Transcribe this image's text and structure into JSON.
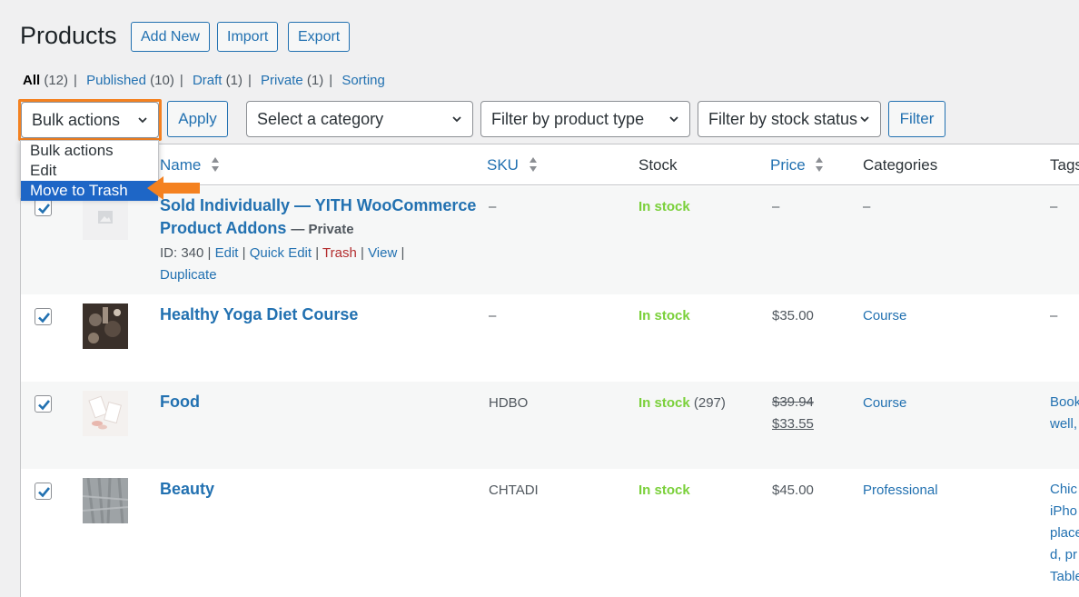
{
  "header": {
    "title": "Products",
    "buttons": [
      "Add New",
      "Import",
      "Export"
    ]
  },
  "views": [
    {
      "label": "All",
      "count": "(12)",
      "current": true
    },
    {
      "label": "Published",
      "count": "(10)"
    },
    {
      "label": "Draft",
      "count": "(1)"
    },
    {
      "label": "Private",
      "count": "(1)"
    },
    {
      "label": "Sorting",
      "count": ""
    }
  ],
  "toolbar": {
    "bulk_actions": "Bulk actions",
    "apply": "Apply",
    "category": "Select a category",
    "product_type": "Filter by product type",
    "stock_status": "Filter by stock status",
    "filter": "Filter"
  },
  "bulk_dropdown": {
    "options": [
      "Bulk actions",
      "Edit",
      "Move to Trash"
    ],
    "selected": "Move to Trash"
  },
  "columns": {
    "name": "Name",
    "sku": "SKU",
    "stock": "Stock",
    "price": "Price",
    "categories": "Categories",
    "tags": "Tags"
  },
  "rows": [
    {
      "name_line1": "Sold Individually — YITH WooCommerce",
      "name_line2": "Product Addons",
      "status": "— Private",
      "actions": {
        "id": "ID: 340",
        "edit": "Edit",
        "quick_edit": "Quick Edit",
        "trash": "Trash",
        "view": "View",
        "duplicate": "Duplicate"
      },
      "sku": "–",
      "stock": "In stock",
      "price": "–",
      "categories": "–",
      "tags": "–",
      "checked": true
    },
    {
      "name": "Healthy Yoga Diet Course",
      "sku": "–",
      "stock": "In stock",
      "price": "$35.00",
      "categories": "Course",
      "tags": "–",
      "checked": true
    },
    {
      "name": "Food",
      "sku": "HDBO",
      "stock": "In stock",
      "stock_qty": "(297)",
      "price_old": "$39.94",
      "price_new": "$33.55",
      "categories": "Course",
      "tags_lines": [
        "Book",
        "well,"
      ],
      "checked": true
    },
    {
      "name": "Beauty",
      "sku": "CHTADI",
      "stock": "In stock",
      "price": "$45.00",
      "categories": "Professional",
      "tags_lines": [
        "Chic",
        "iPho",
        "place",
        "d, pr",
        "Table"
      ],
      "checked": true
    }
  ],
  "colors": {
    "accent": "#2271b1",
    "highlight": "#f48120",
    "instock": "#7ad03a",
    "selected_option": "#1e66c6"
  }
}
